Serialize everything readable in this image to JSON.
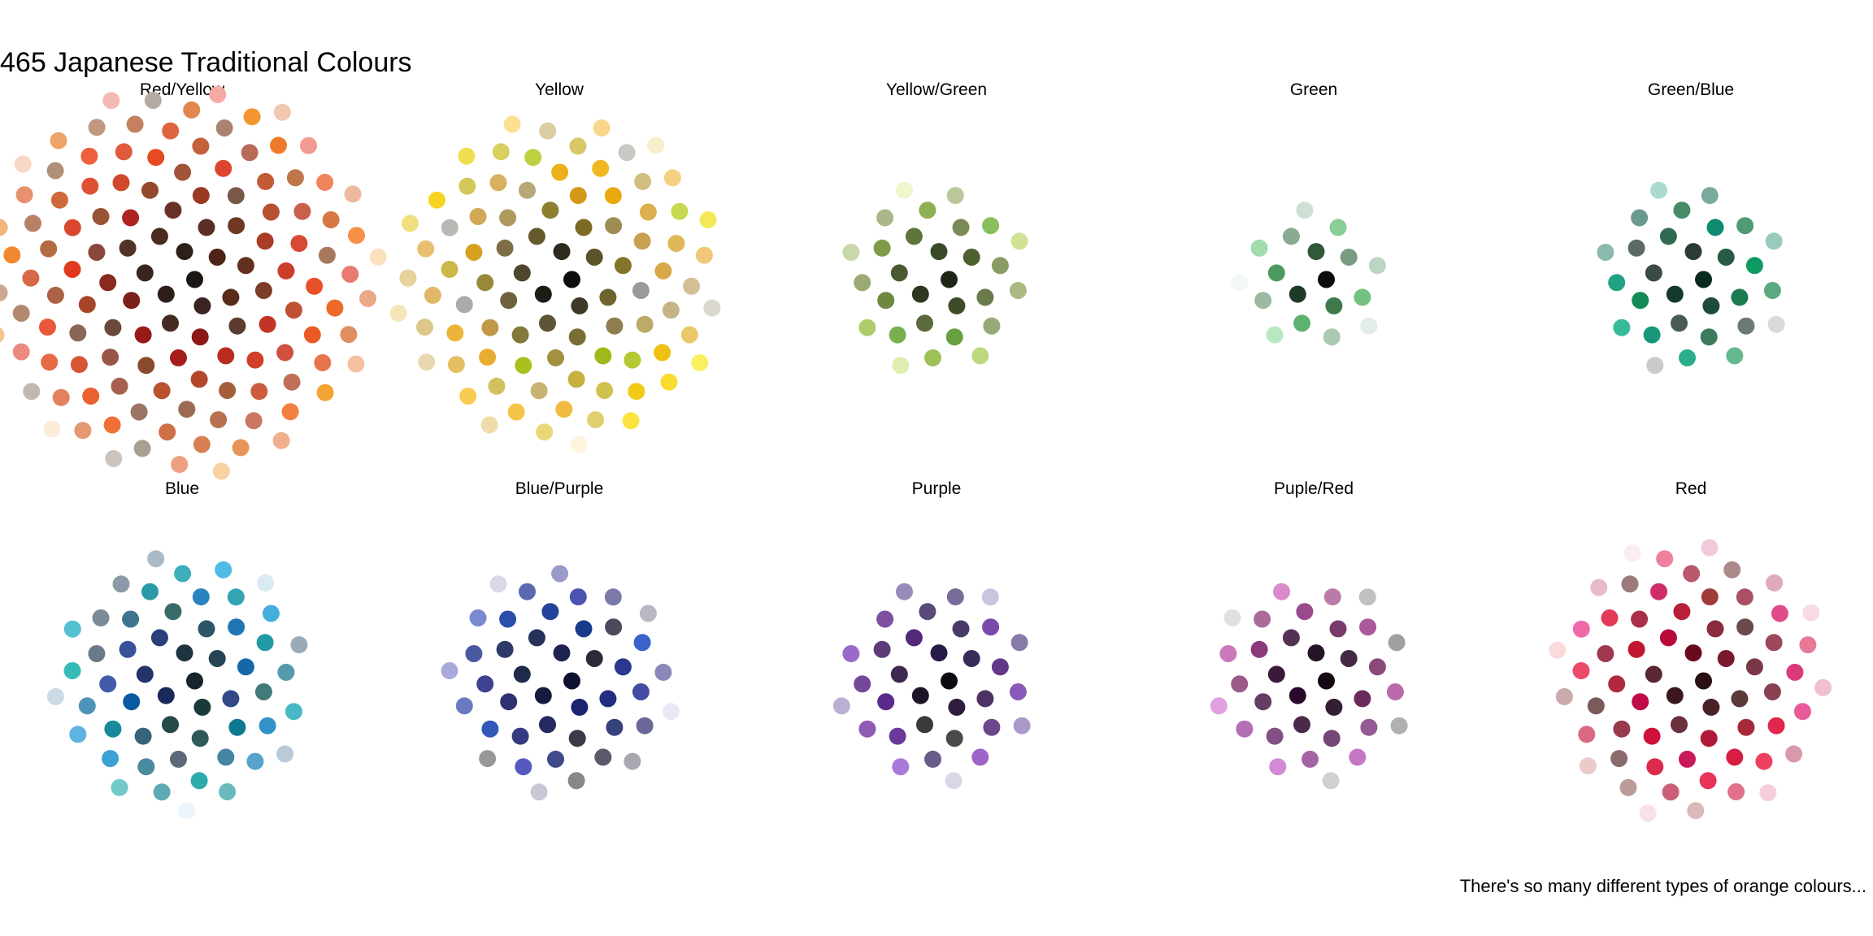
{
  "chart_data": {
    "type": "scatter",
    "title": "465 Japanese Traditional Colours",
    "caption": "There's so many different types of orange colours...",
    "grid": false,
    "legend": "none",
    "facets": [
      {
        "name": "Red/Yellow",
        "colors": [
          "#1c1614",
          "#2d1c18",
          "#3a2320",
          "#4a2a22",
          "#5a2e24",
          "#6a3226",
          "#7a1f1a",
          "#8a2a1e",
          "#9a3a22",
          "#a84428",
          "#b65030",
          "#c25a34",
          "#cc6a3c",
          "#d67844",
          "#e0864e",
          "#e89458",
          "#eea468",
          "#f2b47a",
          "#f6c48e",
          "#f8d2a4",
          "#fae0bc",
          "#fcecd8",
          "#e23a1e",
          "#e64a22",
          "#ea5a24",
          "#ee6a28",
          "#f07a2c",
          "#f2882e",
          "#f39630",
          "#f4a432",
          "#dc4430",
          "#d05040",
          "#c8604c",
          "#c07058",
          "#b88066",
          "#b09078",
          "#a8a090",
          "#b4aca4",
          "#c0b8b2",
          "#ccc4be",
          "#e87a70",
          "#ec8a80",
          "#f09a90",
          "#f4aaa2",
          "#f6bab4",
          "#8a4a2c",
          "#985434",
          "#a65e3a",
          "#b46a42",
          "#c0764a",
          "#7c3e26",
          "#6e3822",
          "#64301e",
          "#5a2a1a",
          "#4e2418",
          "#9c6a52",
          "#a8785e",
          "#b48870",
          "#c09880",
          "#cca892",
          "#e05a3c",
          "#e66a44",
          "#d84a34",
          "#cc3e2c",
          "#c23426",
          "#b82c22",
          "#ae2420",
          "#a41e1c",
          "#981a1a",
          "#8c1818",
          "#e09060",
          "#d88052",
          "#ce7046",
          "#c4603a",
          "#ba5230",
          "#6a4a3a",
          "#7a5848",
          "#8a6656",
          "#9a7464",
          "#aa8272",
          "#f0845a",
          "#e8744c",
          "#e06440",
          "#d85636",
          "#d0482c",
          "#5c3c30",
          "#503428",
          "#442c22",
          "#38261e",
          "#2c2018",
          "#f4c0a0",
          "#f0b090",
          "#eca080",
          "#e89070",
          "#e48060",
          "#c48060",
          "#b87050",
          "#ac6244",
          "#a05438",
          "#94482e",
          "#e85028",
          "#ec6030",
          "#f07038",
          "#f48040",
          "#f89048",
          "#d86848",
          "#cc5c3e",
          "#c05034",
          "#b4462c",
          "#a83c24",
          "#f6d8c4",
          "#f2c8b0",
          "#eeb89c",
          "#eaa888",
          "#e69874",
          "#88483a",
          "#985444",
          "#a8604e",
          "#b86c58",
          "#c87862",
          "#f06040",
          "#e8583a",
          "#e05034",
          "#d8482e",
          "#d04028"
        ],
        "count": 125
      },
      {
        "name": "Yellow",
        "colors": [
          "#0e0e0c",
          "#1e1c16",
          "#2e2a1e",
          "#3e3826",
          "#4e462e",
          "#5e5436",
          "#6e623e",
          "#7e7046",
          "#8e7e4e",
          "#9e8c56",
          "#ae9a5e",
          "#beaa68",
          "#c8b472",
          "#d2be7e",
          "#dcc88c",
          "#e6d29a",
          "#eedcaa",
          "#f4e6ba",
          "#f8eecc",
          "#fbf4de",
          "#f0c010",
          "#f4ca18",
          "#f8d420",
          "#fadc30",
          "#fce440",
          "#e8a810",
          "#ecb018",
          "#f0b820",
          "#d49818",
          "#d8a020",
          "#a0b818",
          "#aac020",
          "#b4c830",
          "#bed040",
          "#c8d850",
          "#7a6a24",
          "#847428",
          "#8e7e30",
          "#988838",
          "#a29240",
          "#5a5228",
          "#645a2c",
          "#6e6430",
          "#786e36",
          "#82783c",
          "#c09848",
          "#c8a050",
          "#d0a858",
          "#d8b060",
          "#e0b868",
          "#e8c070",
          "#f0c878",
          "#f4d080",
          "#f8d888",
          "#fce090",
          "#9a9a9a",
          "#aaaaa8",
          "#bab8b4",
          "#cac8c2",
          "#dad8d0",
          "#e8ac30",
          "#ecb438",
          "#f0bc40",
          "#f4c448",
          "#f8cc50",
          "#b8a878",
          "#c4b486",
          "#d0c094",
          "#dcccA2",
          "#e8d8b0",
          "#d8a848",
          "#dcb050",
          "#e0b858",
          "#e4c060",
          "#e8c868",
          "#d0c060",
          "#d8c868",
          "#e0d070",
          "#e8d878",
          "#f0e080",
          "#c8b040",
          "#ccb848",
          "#d0c050",
          "#d4c858",
          "#d8d060",
          "#f0e050",
          "#f4e858",
          "#f8f060"
        ],
        "count": 88
      },
      {
        "name": "Yellow/Green",
        "colors": [
          "#1e2418",
          "#2e3820",
          "#3e4c28",
          "#4e6030",
          "#5e7438",
          "#6e8840",
          "#7e9c48",
          "#8eb050",
          "#9ec058",
          "#aecc6a",
          "#bed87e",
          "#cee494",
          "#deeeb0",
          "#eef6cc",
          "#5a6a3a",
          "#6a7a48",
          "#7a8a56",
          "#8a9a64",
          "#9aaa72",
          "#aaba82",
          "#4a5a30",
          "#3a4a28",
          "#88c060",
          "#78b050",
          "#68a040",
          "#98a878",
          "#a8b888",
          "#b8c898",
          "#c8d8aa"
        ],
        "count": 29
      },
      {
        "name": "Green",
        "colors": [
          "#0a0e0a",
          "#1e3a28",
          "#2e5a3a",
          "#3e7a4c",
          "#4e9a5e",
          "#5eb270",
          "#72c082",
          "#88ce96",
          "#a0dcac",
          "#b8e8c2",
          "#7a9a82",
          "#8aaa92",
          "#9abaa2",
          "#aac8b2",
          "#bcd4c4",
          "#cedfd4",
          "#e2ecea",
          "#f2f8f4"
        ],
        "count": 18
      },
      {
        "name": "Green/Blue",
        "colors": [
          "#0a2a20",
          "#143a2c",
          "#1e4a38",
          "#285a44",
          "#326a50",
          "#3c7a5c",
          "#468a68",
          "#509a74",
          "#5aaa80",
          "#64ba8c",
          "#0e8a70",
          "#18967a",
          "#22a284",
          "#2cae8e",
          "#36ba98",
          "#6a9a8e",
          "#7aaa9e",
          "#8abaae",
          "#9acabe",
          "#aadace",
          "#2a3a34",
          "#3a4a44",
          "#4a5a54",
          "#5a6a64",
          "#6a7a74",
          "#cacaca",
          "#dadada",
          "#1a7a50",
          "#148a58",
          "#0e9a60"
        ],
        "count": 30
      },
      {
        "name": "Blue",
        "colors": [
          "#16242c",
          "#1e3440",
          "#264454",
          "#2e5468",
          "#36647c",
          "#3e7490",
          "#4684a4",
          "#4e94b8",
          "#56a4cc",
          "#5eb4e0",
          "#0a5aa0",
          "#1468aa",
          "#1e76b4",
          "#2884be",
          "#3292c8",
          "#3ca0d2",
          "#46aedc",
          "#50bce6",
          "#1a2a5a",
          "#22346a",
          "#2a3e7a",
          "#32488a",
          "#3a529a",
          "#425caa",
          "#2a9aa8",
          "#34a4b2",
          "#3eaebc",
          "#48b8c6",
          "#52c2d0",
          "#5a6a78",
          "#6a7a88",
          "#7a8a98",
          "#8a9aa8",
          "#9aaab8",
          "#aabac8",
          "#bacad8",
          "#cadae6",
          "#daeaf2",
          "#eaf4fa",
          "#1a3a3a",
          "#244a4a",
          "#2e5a5a",
          "#386a6a",
          "#427a7a",
          "#0e7a90",
          "#188a9a",
          "#229aa4",
          "#2caaae",
          "#36bab8",
          "#4a8aa0",
          "#549aaa",
          "#5eaab4",
          "#68babe",
          "#72cac8"
        ],
        "count": 54
      },
      {
        "name": "Blue/Purple",
        "colors": [
          "#0e1230",
          "#161a40",
          "#1e2250",
          "#262a60",
          "#2e3270",
          "#363a80",
          "#3e4290",
          "#464aa0",
          "#4e52b0",
          "#565ac0",
          "#1e2a4a",
          "#26325a",
          "#2e3a6a",
          "#36427a",
          "#3e4a8a",
          "#1a3a8a",
          "#22449a",
          "#2a4eaa",
          "#3258ba",
          "#3a62ca",
          "#6a6a9a",
          "#7a7aaa",
          "#8a8aba",
          "#9a9aca",
          "#aaaada",
          "#888888",
          "#989898",
          "#a8a8b0",
          "#b8b8c4",
          "#c8c8d8",
          "#d8d8e8",
          "#e8e8f6",
          "#2a2a3a",
          "#3a3a4a",
          "#4a4a5a",
          "#5a5a6a",
          "#4a5aa0",
          "#5a6ab0",
          "#6a7ac0",
          "#7a8ad0",
          "#1a2470",
          "#222e80",
          "#2a3890"
        ],
        "count": 43
      },
      {
        "name": "Purple",
        "colors": [
          "#0e0a14",
          "#1e1428",
          "#2e1e3c",
          "#3e2850",
          "#4e3264",
          "#5e3c78",
          "#6e468c",
          "#7e50a0",
          "#8e5ab4",
          "#9e64c8",
          "#2a1a4a",
          "#3a2a5a",
          "#4a3a6a",
          "#5a4a7a",
          "#6a5a8a",
          "#7a6a9a",
          "#8a7aaa",
          "#9a8aba",
          "#aa9aca",
          "#bab0d6",
          "#cac4e0",
          "#dad8e8",
          "#3a3a3a",
          "#4a4a4a",
          "#5a2a8a",
          "#6a3a9a",
          "#7a4aaa",
          "#8a5aba",
          "#9a6aca",
          "#aa7ada",
          "#542878",
          "#643888",
          "#744898"
        ],
        "count": 33
      },
      {
        "name": "Puple/Red",
        "colors": [
          "#140a14",
          "#241424",
          "#341e34",
          "#442844",
          "#543254",
          "#643c64",
          "#744674",
          "#845084",
          "#945a94",
          "#a464a4",
          "#b46eb4",
          "#c478c4",
          "#d48ad4",
          "#e0a0e0",
          "#6a2a5a",
          "#7a3a6a",
          "#8a4a7a",
          "#9a5a8a",
          "#aa6a9a",
          "#ba7aaa",
          "#a0a0a0",
          "#b0b0b0",
          "#c0c0c0",
          "#d0d0d0",
          "#e0e0e0",
          "#2a0a2a",
          "#3a1a3a",
          "#4a2a4a",
          "#8a3a7a",
          "#9a4a8a",
          "#aa5a9a",
          "#ba6aaa",
          "#ca7aba",
          "#da8aca"
        ],
        "count": 34
      },
      {
        "name": "Red",
        "colors": [
          "#2a1014",
          "#3a181e",
          "#4a2028",
          "#5a2832",
          "#6a303c",
          "#7a3846",
          "#8a4050",
          "#9a485a",
          "#aa5064",
          "#ba586e",
          "#ca6078",
          "#da6882",
          "#e0708c",
          "#e87896",
          "#f080a0",
          "#d0103a",
          "#d81c44",
          "#e0284e",
          "#e83458",
          "#f04062",
          "#c01830",
          "#b82038",
          "#b02840",
          "#a83048",
          "#a03850",
          "#983a4e",
          "#8a2a3e",
          "#7a1a2e",
          "#6a0a1e",
          "#5a3a3a",
          "#6a4a4a",
          "#7a5a5a",
          "#8a6a6a",
          "#9a7a7a",
          "#aa8a8a",
          "#ba9a9a",
          "#caaaaa",
          "#dababa",
          "#eacaca",
          "#fadada",
          "#e04a8a",
          "#e85a9a",
          "#f06aaa",
          "#d83a7a",
          "#d02a6a",
          "#c81a5a",
          "#c00a4a",
          "#b80a3a",
          "#b01a3a",
          "#a82a3a",
          "#a03a3a",
          "#f0c0d0",
          "#f4d0dc",
          "#f8e0e8",
          "#fcecf0",
          "#d89aaa",
          "#e0aaba",
          "#e8baca",
          "#f0cada",
          "#f8dae6",
          "#dc2a4a",
          "#e43a5a",
          "#ec4a6a"
        ],
        "count": 63
      }
    ]
  }
}
